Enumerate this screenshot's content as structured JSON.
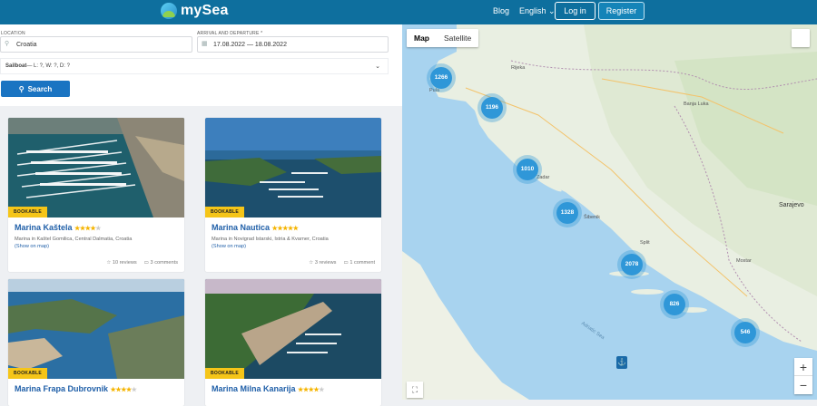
{
  "header": {
    "logo_text": "mySea",
    "blog": "Blog",
    "language": "English",
    "login": "Log in",
    "register": "Register",
    "bg_color": "#0e6f9e"
  },
  "filters": {
    "location_label": "LOCATION",
    "location_value": "Croatia",
    "dates_label": "ARRIVAL AND DEPARTURE *",
    "dates_value": "17.08.2022 — 18.08.2022",
    "boat_label": "Sailboat",
    "boat_value": " — L: ?, W: ?, D: ?",
    "search_button": "Search"
  },
  "cards": [
    {
      "title": "Marina Kaštela",
      "stars": 4,
      "badge": "BOOKABLE",
      "address": "Marina in Kaštel Gomilica, Central Dalmatia, Croatia",
      "show_on_map": "(Show on map)",
      "reviews": "10 reviews",
      "comments": "3 comments"
    },
    {
      "title": "Marina Nautica",
      "stars": 5,
      "badge": "BOOKABLE",
      "address": "Marina in Novigrad Istarski, Istria & Kvarner, Croatia",
      "show_on_map": "(Show on map)",
      "reviews": "3 reviews",
      "comments": "1 comment"
    },
    {
      "title": "Marina Frapa Dubrovnik",
      "stars": 4,
      "badge": "BOOKABLE",
      "address": "",
      "show_on_map": "",
      "reviews": "",
      "comments": ""
    },
    {
      "title": "Marina Milna Kanarija",
      "stars": 4,
      "badge": "BOOKABLE",
      "address": "",
      "show_on_map": "",
      "reviews": "",
      "comments": ""
    }
  ],
  "map": {
    "tab_map": "Map",
    "tab_satellite": "Satellite",
    "clusters": [
      "1266",
      "1196",
      "1010",
      "1328",
      "2078",
      "826",
      "546"
    ],
    "labels": {
      "sarajevo": "Sarajevo",
      "split": "Split",
      "zadar": "Zadar",
      "pula": "Pula",
      "banja_luka": "Banja Luka",
      "mostar": "Mostar",
      "rijeka": "Rijeka",
      "sibenik": "Šibenik"
    },
    "sea_label": "Adriatic Sea"
  }
}
